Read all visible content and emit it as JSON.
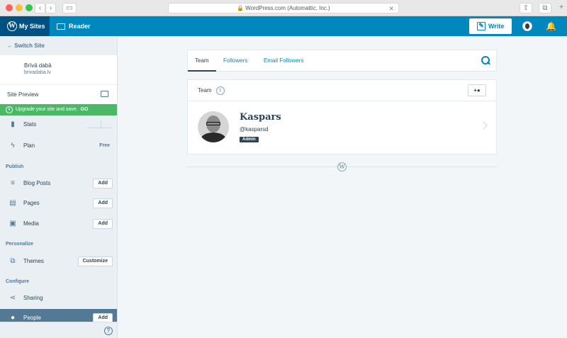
{
  "browser": {
    "url": "WordPress.com (Automattic, Inc.)",
    "colors": {
      "close": "#fc605c",
      "minimize": "#fdbc40",
      "zoom": "#34c84a"
    }
  },
  "masterbar": {
    "my_sites": "My Sites",
    "reader": "Reader",
    "write": "Write",
    "background": "#0087be"
  },
  "sidebar": {
    "switch_site": "Switch Site",
    "site_name": "Brīvā dabā",
    "site_domain": "brivadaba.lv",
    "site_preview": "Site Preview",
    "upgrade_text": "Upgrade your site and save.",
    "upgrade_go": "GO",
    "stats": "Stats",
    "plan": "Plan",
    "plan_value": "Free",
    "publish_heading": "Publish",
    "blog_posts": "Blog Posts",
    "pages": "Pages",
    "media": "Media",
    "add": "Add",
    "personalize_heading": "Personalize",
    "themes": "Themes",
    "customize": "Customize",
    "configure_heading": "Configure",
    "sharing": "Sharing",
    "people": "People"
  },
  "tabs": [
    {
      "label": "Team",
      "active": true
    },
    {
      "label": "Followers",
      "active": false
    },
    {
      "label": "Email Followers",
      "active": false
    }
  ],
  "team": {
    "label": "Team",
    "count": "1"
  },
  "person": {
    "name": "Kaspars",
    "login": "@kasparsd",
    "role": "Admin"
  }
}
